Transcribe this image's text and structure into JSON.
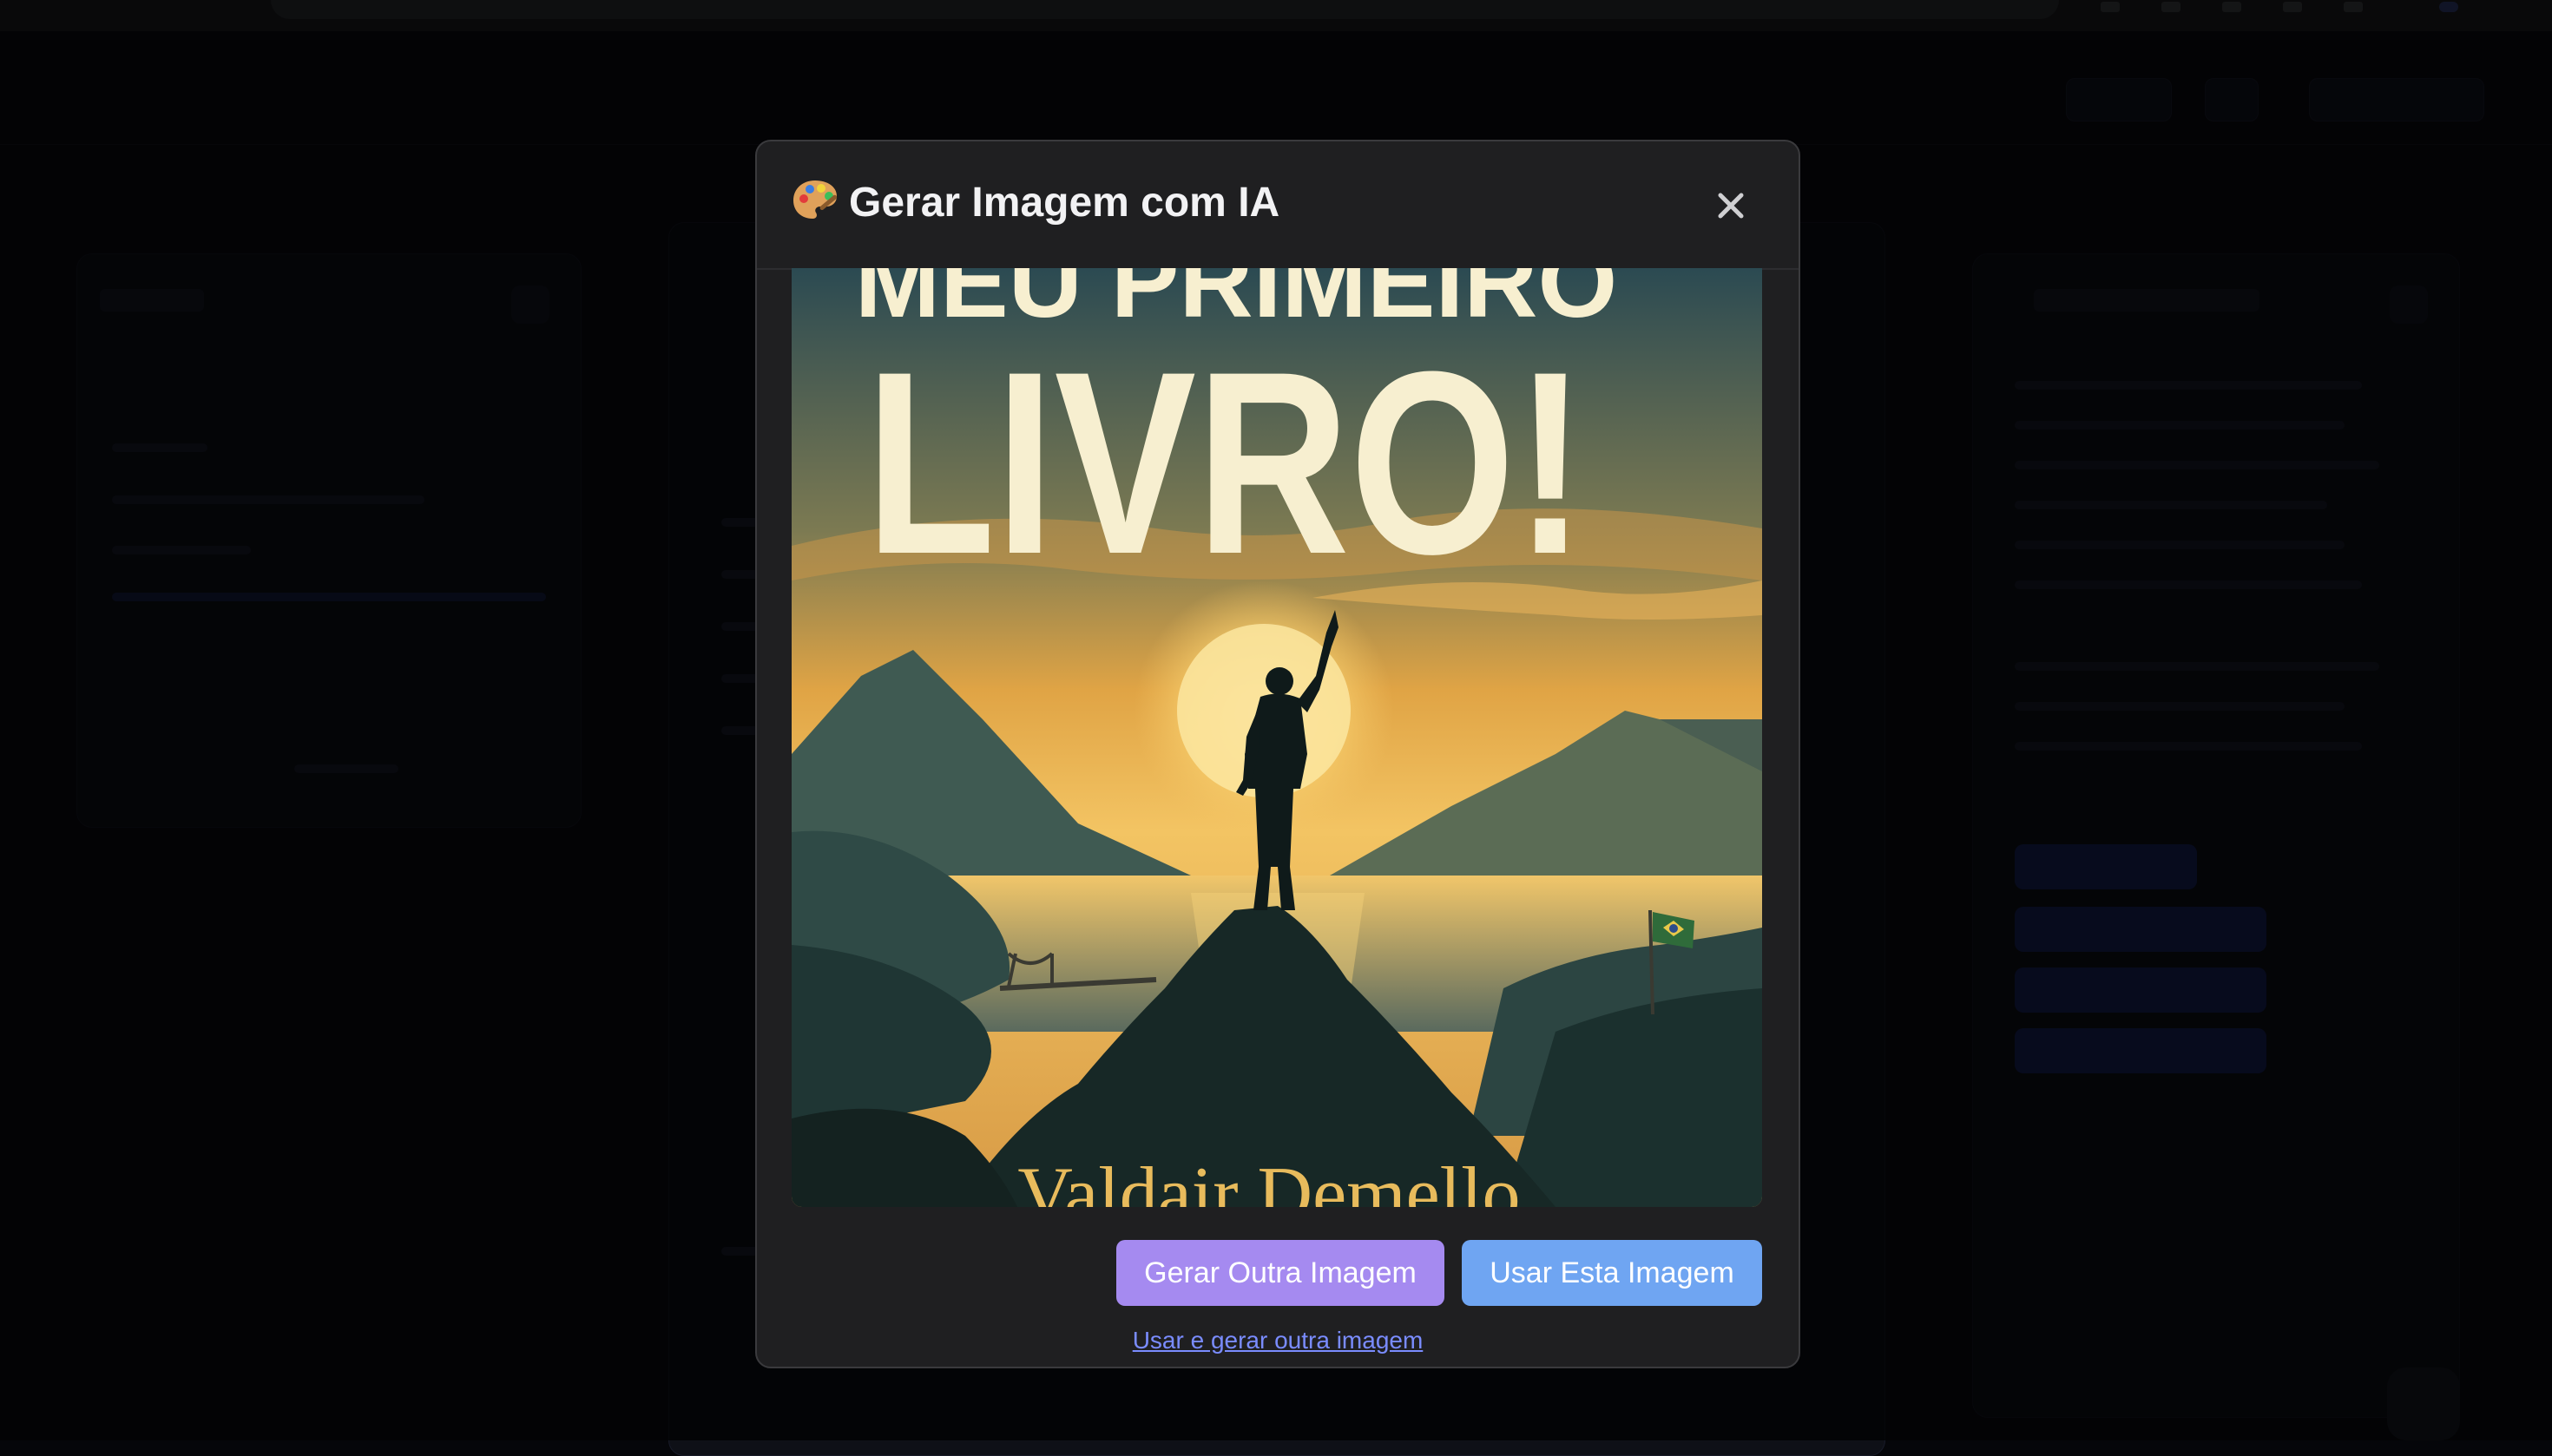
{
  "modal": {
    "title": "Gerar Imagem com IA",
    "close_label": "×",
    "image": {
      "title_line1": "MEU PRIMEIRO",
      "title_line2": "LIVRO!",
      "author": "Valdair Demello"
    },
    "buttons": {
      "generate_another": "Gerar Outra Imagem",
      "use_this": "Usar Esta Imagem"
    },
    "link_use_and_generate": "Usar e gerar outra imagem"
  },
  "colors": {
    "generate_button": "#a58af0",
    "use_button": "#6fa5f2",
    "link": "#7a8cff",
    "modal_bg": "#1f1f21"
  },
  "icons": [
    "palette-icon",
    "close-icon"
  ]
}
